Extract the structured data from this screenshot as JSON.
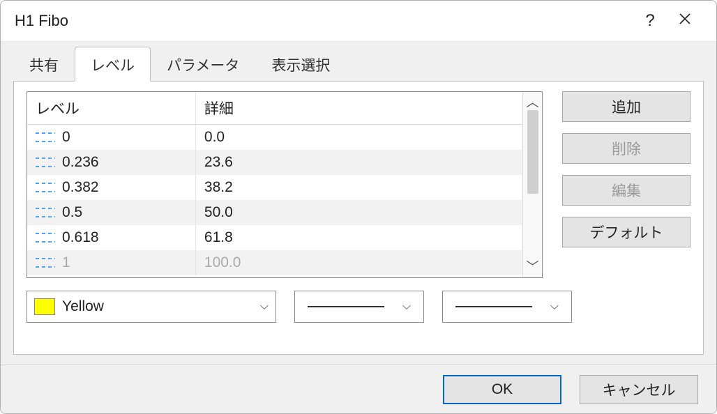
{
  "window": {
    "title": "H1 Fibo"
  },
  "tabs": [
    "共有",
    "レベル",
    "パラメータ",
    "表示選択"
  ],
  "active_tab_index": 1,
  "table": {
    "headers": [
      "レベル",
      "詳細"
    ],
    "rows": [
      {
        "level": "0",
        "detail": "0.0"
      },
      {
        "level": "0.236",
        "detail": "23.6"
      },
      {
        "level": "0.382",
        "detail": "38.2"
      },
      {
        "level": "0.5",
        "detail": "50.0"
      },
      {
        "level": "0.618",
        "detail": "61.8"
      },
      {
        "level": "1",
        "detail": "100.0"
      }
    ]
  },
  "side_buttons": {
    "add": "追加",
    "delete": "削除",
    "edit": "編集",
    "default": "デフォルト"
  },
  "color_combo": {
    "name": "Yellow",
    "swatch": "#ffff00"
  },
  "footer": {
    "ok": "OK",
    "cancel": "キャンセル"
  }
}
